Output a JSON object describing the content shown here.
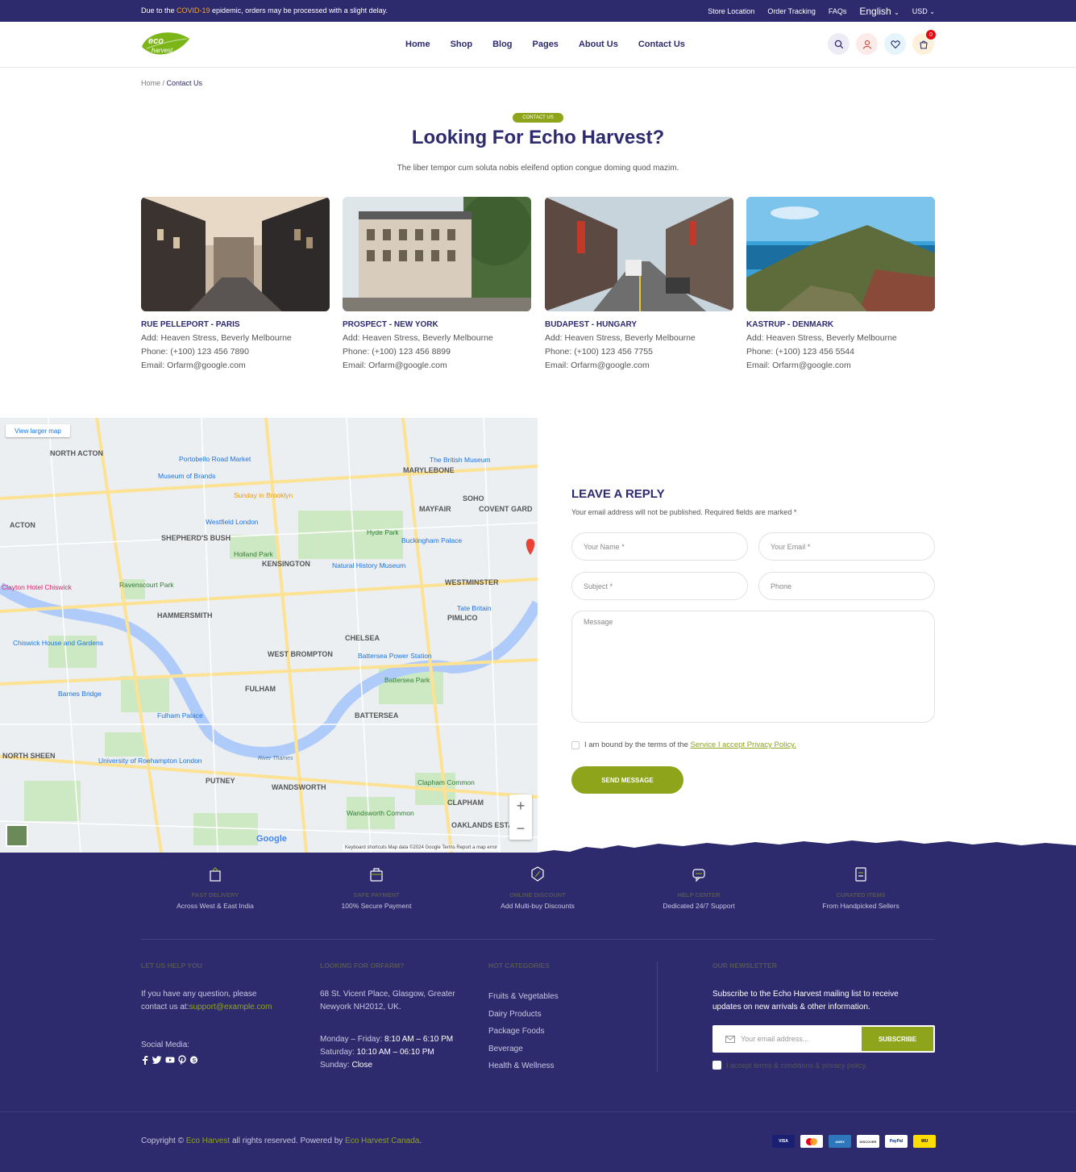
{
  "topbar": {
    "notice_pre": "Due to the ",
    "notice_hl": "COVID-19",
    "notice_post": " epidemic, orders may be processed with a slight delay.",
    "links": [
      "Store Location",
      "Order Tracking",
      "FAQs"
    ],
    "language": "English",
    "currency": "USD"
  },
  "logo": {
    "line1": "eco",
    "line2": "harvest"
  },
  "nav": [
    "Home",
    "Shop",
    "Blog",
    "Pages",
    "About Us",
    "Contact Us"
  ],
  "cart_count": "0",
  "breadcrumb": {
    "home": "Home",
    "sep": " / ",
    "current": "Contact Us"
  },
  "hero": {
    "pill": "CONTACT US",
    "title": "Looking For Echo Harvest?",
    "subtitle": "The liber tempor cum soluta nobis eleifend option congue doming quod mazim."
  },
  "locations": [
    {
      "title": "RUE PELLEPORT - PARIS",
      "address": "Add: Heaven Stress, Beverly Melbourne",
      "phone": "Phone: (+100) 123 456 7890",
      "email": "Email: Orfarm@google.com"
    },
    {
      "title": "PROSPECT - NEW YORK",
      "address": "Add: Heaven Stress, Beverly Melbourne",
      "phone": "Phone: (+100) 123 456 8899",
      "email": "Email: Orfarm@google.com"
    },
    {
      "title": "BUDAPEST - HUNGARY",
      "address": "Add: Heaven Stress, Beverly Melbourne",
      "phone": "Phone: (+100) 123 456 7755",
      "email": "Email: Orfarm@google.com"
    },
    {
      "title": "KASTRUP - DENMARK",
      "address": "Add: Heaven Stress, Beverly Melbourne",
      "phone": "Phone: (+100) 123 456 5544",
      "email": "Email: Orfarm@google.com"
    }
  ],
  "map": {
    "larger_link": "View larger map",
    "footer": "Keyboard shortcuts   Map data ©2024 Google   Terms   Report a map error",
    "google": "Google",
    "labels": [
      "NORTH ACTON",
      "MARYLEBONE",
      "SOHO",
      "MAYFAIR",
      "COVENT GARD",
      "ACTON",
      "SHEPHERD'S BUSH",
      "KENSINGTON",
      "Hyde Park",
      "Holland Park",
      "WESTMINSTER",
      "HAMMERSMITH",
      "CHELSEA",
      "PIMLICO",
      "WEST BROMPTON",
      "FULHAM",
      "BATTERSEA",
      "PUTNEY",
      "WANDSWORTH",
      "CLAPHAM",
      "NORTH SHEEN",
      "River Thames",
      "Portobello Road Market",
      "Westfield London",
      "Natural History Museum",
      "Buckingham Palace",
      "Battersea Power Station",
      "Battersea Park",
      "Fulham Palace",
      "Barnes Bridge",
      "Chiswick House and Gardens",
      "Clayton Hotel Chiswick",
      "The British Museum",
      "Tate Britain",
      "Wandsworth Common",
      "Clapham Common",
      "OAKLANDS ESTATE",
      "Sunday in Brooklyn",
      "Museum of Brands",
      "Ravenscourt Park",
      "University of Roehampton London"
    ]
  },
  "form": {
    "title": "LEAVE A REPLY",
    "note": "Your email address will not be published. Required fields are marked *",
    "name_ph": "Your Name *",
    "email_ph": "Your Email *",
    "subject_ph": "Subject *",
    "phone_ph": "Phone",
    "message_ph": "Message",
    "terms_pre": "I am bound by the terms of the ",
    "terms_link": "Service I accept Privacy Policy.",
    "submit": "SEND MESSAGE"
  },
  "features": [
    {
      "title": "FAST DELIVERY",
      "desc": "Across West & East India",
      "icon": "delivery-icon"
    },
    {
      "title": "SAFE PAYMENT",
      "desc": "100% Secure Payment",
      "icon": "payment-icon"
    },
    {
      "title": "ONLINE DISCOUNT",
      "desc": "Add Multi-buy Discounts",
      "icon": "discount-icon"
    },
    {
      "title": "HELP CENTER",
      "desc": "Dedicated 24/7 Support",
      "icon": "help-icon"
    },
    {
      "title": "CURATED ITEMS",
      "desc": "From Handpicked Sellers",
      "icon": "curated-icon"
    }
  ],
  "footer": {
    "help": {
      "title": "LET US HELP YOU",
      "text1": "If you have any question, please",
      "text2_pre": "contact us at:",
      "email": "support@example.com",
      "social_label": "Social Media:"
    },
    "looking": {
      "title": "LOOKING FOR ORFARM?",
      "addr1": "68 St. Vicent Place, Glasgow, Greater",
      "addr2": "Newyork NH2012, UK.",
      "h1_label": "Monday – Friday: ",
      "h1_value": "8:10 AM – 6:10 PM",
      "h2_label": "Saturday: ",
      "h2_value": "10:10 AM – 06:10 PM",
      "h3_label": "Sunday: ",
      "h3_value": "Close"
    },
    "categories": {
      "title": "HOT CATEGORIES",
      "items": [
        "Fruits & Vegetables",
        "Dairy Products",
        "Package Foods",
        "Beverage",
        "Health & Wellness"
      ]
    },
    "newsletter": {
      "title": "OUR NEWSLETTER",
      "text1": "Subscribe to the Echo Harvest mailing list to receive",
      "text2": "updates on new arrivals & other information.",
      "placeholder": "Your email address...",
      "button": "SUBSCRIBE",
      "accept": "I accept terms & conditions & privacy policy."
    },
    "copyright": {
      "pre": "Copyright © ",
      "brand": "Eco Harvest",
      "mid": " all rights reserved. Powered by ",
      "powered": "Eco Harvest Canada",
      "end": "."
    },
    "payments": [
      "VISA",
      "MC",
      "AMEX",
      "DISCOVER",
      "PayPal",
      "WU"
    ]
  },
  "colors": {
    "primary": "#2d2a6e",
    "accent": "#8ea51b",
    "highlight": "#f5a623"
  }
}
